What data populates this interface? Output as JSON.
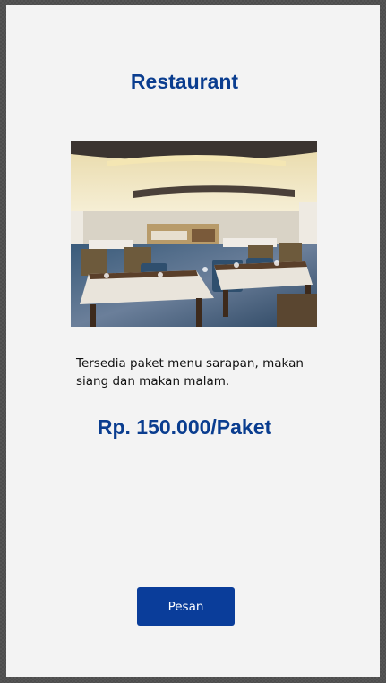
{
  "page": {
    "title": "Restaurant",
    "description": "Tersedia paket menu sarapan, makan siang dan makan malam.",
    "price": "Rp. 150.000/Paket",
    "order_button_label": "Pesan"
  },
  "colors": {
    "accent": "#0a3d8f",
    "button": "#0a3d9a",
    "panel_bg": "#f3f3f3"
  }
}
